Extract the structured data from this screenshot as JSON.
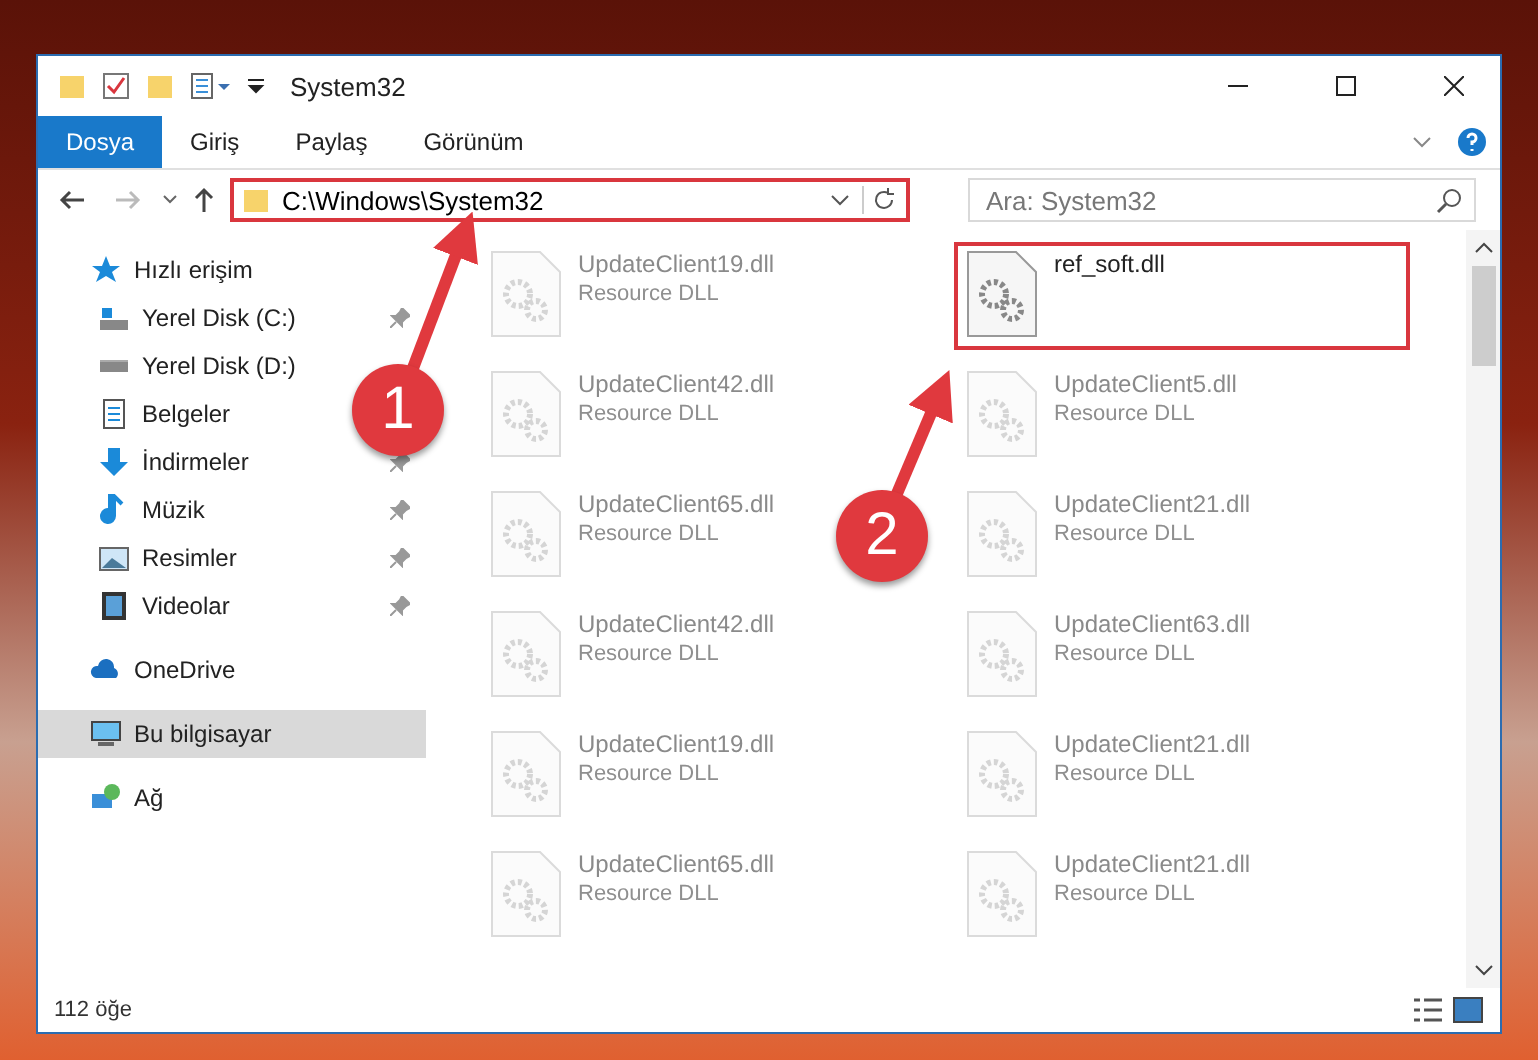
{
  "window": {
    "title": "System32"
  },
  "ribbon_tabs": [
    {
      "label": "Dosya",
      "selected": true
    },
    {
      "label": "Giriş",
      "selected": false
    },
    {
      "label": "Paylaş",
      "selected": false
    },
    {
      "label": "Görünüm",
      "selected": false
    }
  ],
  "address": {
    "path": "C:\\Windows\\System32",
    "highlighted": true
  },
  "search": {
    "placeholder": "Ara: System32"
  },
  "sidebar": [
    {
      "label": "Hızlı erişim",
      "kind": "quick",
      "pinned": false,
      "selected": false,
      "children": [
        {
          "label": "Yerel Disk (C:)",
          "kind": "diskc",
          "pinned": true,
          "selected": false
        },
        {
          "label": "Yerel Disk (D:)",
          "kind": "disk",
          "pinned": false,
          "selected": false
        },
        {
          "label": "Belgeler",
          "kind": "docs",
          "pinned": false,
          "selected": false
        },
        {
          "label": "İndirmeler",
          "kind": "down",
          "pinned": true,
          "selected": false
        },
        {
          "label": "Müzik",
          "kind": "music",
          "pinned": true,
          "selected": false
        },
        {
          "label": "Resimler",
          "kind": "pics",
          "pinned": true,
          "selected": false
        },
        {
          "label": "Videolar",
          "kind": "video",
          "pinned": true,
          "selected": false
        }
      ]
    },
    {
      "label": "OneDrive",
      "kind": "cloud",
      "pinned": false,
      "selected": false
    },
    {
      "label": "Bu bilgisayar",
      "kind": "pc",
      "pinned": false,
      "selected": true
    },
    {
      "label": "Ağ",
      "kind": "net",
      "pinned": false,
      "selected": false
    }
  ],
  "files": [
    {
      "name": "UpdateClient19.dll",
      "type": "Resource DLL",
      "faded": true,
      "highlighted": false
    },
    {
      "name": "ref_soft.dll",
      "faded": false,
      "highlighted": true
    },
    {
      "name": "UpdateClient42.dll",
      "type": "Resource DLL",
      "faded": true,
      "highlighted": false
    },
    {
      "name": "UpdateClient5.dll",
      "type": "Resource DLL",
      "faded": true,
      "highlighted": false
    },
    {
      "name": "UpdateClient65.dll",
      "type": "Resource DLL",
      "faded": true,
      "highlighted": false
    },
    {
      "name": "UpdateClient21.dll",
      "type": "Resource DLL",
      "faded": true,
      "highlighted": false
    },
    {
      "name": "UpdateClient42.dll",
      "type": "Resource DLL",
      "faded": true,
      "highlighted": false
    },
    {
      "name": "UpdateClient63.dll",
      "type": "Resource DLL",
      "faded": true,
      "highlighted": false
    },
    {
      "name": "UpdateClient19.dll",
      "type": "Resource DLL",
      "faded": true,
      "highlighted": false
    },
    {
      "name": "UpdateClient21.dll",
      "type": "Resource DLL",
      "faded": true,
      "highlighted": false
    },
    {
      "name": "UpdateClient65.dll",
      "type": "Resource DLL",
      "faded": true,
      "highlighted": false
    },
    {
      "name": "UpdateClient21.dll",
      "type": "Resource DLL",
      "faded": true,
      "highlighted": false
    }
  ],
  "status_bar": {
    "count": "112 öğe"
  },
  "markers": [
    {
      "number": "1"
    },
    {
      "number": "2"
    }
  ]
}
